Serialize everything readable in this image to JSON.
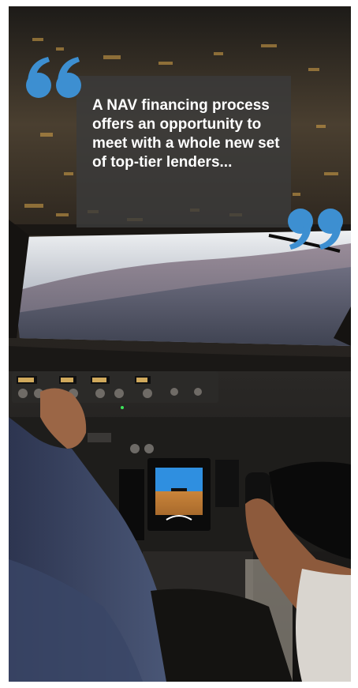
{
  "quote": {
    "text": "A NAV financing process offers an opportunity to meet with a whole new set of top-tier lenders..."
  },
  "icons": {
    "open_quote": "left-double-quote-icon",
    "close_quote": "right-double-quote-icon"
  },
  "colors": {
    "quote_mark": "#3d8fd1",
    "quote_box": "#3a3a3a",
    "quote_text": "#ffffff"
  }
}
